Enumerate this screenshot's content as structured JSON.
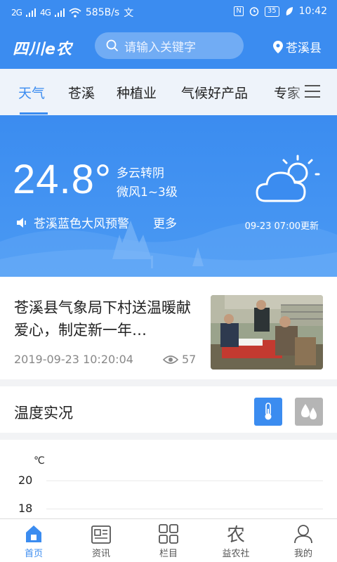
{
  "status_bar": {
    "signal1": "2G",
    "signal2": "4G",
    "speed": "585B/s",
    "battery": "35",
    "time": "10:42"
  },
  "header": {
    "logo": "四川e农",
    "search_placeholder": "请输入关键字",
    "location": "苍溪县"
  },
  "tabs": [
    {
      "label": "天气",
      "active": true
    },
    {
      "label": "苍溪",
      "active": false
    },
    {
      "label": "种植业",
      "active": false
    },
    {
      "label": "气候好产品",
      "active": false
    },
    {
      "label": "专家",
      "active": false
    }
  ],
  "weather": {
    "temperature": "24.8°",
    "condition": "多云转阴",
    "wind": "微风1~3级",
    "alert": "苍溪蓝色大风预警",
    "more": "更多",
    "updated": "09-23 07:00更新"
  },
  "news": {
    "title": "苍溪县气象局下村送温暖献爱心，制定新一年…",
    "date": "2019-09-23 10:20:04",
    "views": "57"
  },
  "temp_section": {
    "title": "温度实况"
  },
  "chart_data": {
    "type": "line",
    "unit": "℃",
    "yticks": [
      "20",
      "18"
    ]
  },
  "bottom_nav": [
    {
      "label": "首页",
      "icon": "home-icon",
      "active": true
    },
    {
      "label": "资讯",
      "icon": "news-icon",
      "active": false
    },
    {
      "label": "栏目",
      "icon": "grid-icon",
      "active": false
    },
    {
      "label": "益农社",
      "icon": "nong-icon",
      "active": false
    },
    {
      "label": "我的",
      "icon": "user-icon",
      "active": false
    }
  ],
  "colors": {
    "primary": "#3b8cf0",
    "tab_bg": "#eef3fa",
    "inactive_toggle": "#b5b5b5"
  }
}
